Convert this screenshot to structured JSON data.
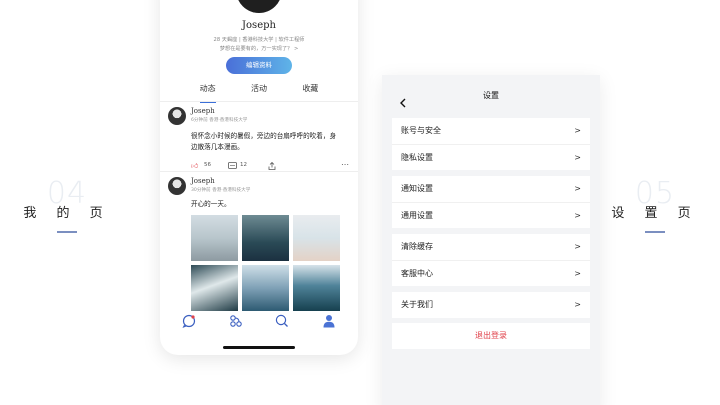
{
  "sections": {
    "left": {
      "number": "04",
      "title": "我 的 页"
    },
    "right": {
      "number": "05",
      "title": "设 置 页"
    }
  },
  "profile": {
    "name": "Joseph",
    "meta": "28 天蝎座 | 香港科技大学 | 软件工程师",
    "bio": "梦想在是要有的，万一实现了？ >",
    "edit_label": "编辑资料",
    "tabs": [
      "动态",
      "活动",
      "收藏"
    ],
    "active_tab": "动态"
  },
  "posts": [
    {
      "name": "Joseph",
      "sub": "6分钟前   香港·香港科技大学",
      "body": "很怀念小时候的暑假，旁边的台扇呼呼的吹着，身边散落几本漫画。",
      "likes": "56",
      "comments": "12"
    },
    {
      "name": "Joseph",
      "sub": "30分钟前   香港·香港科技大学",
      "body": "开心的一天。"
    }
  ],
  "settings": {
    "title": "设置",
    "groups": [
      [
        "账号与安全",
        "隐私设置"
      ],
      [
        "通知设置",
        "通用设置"
      ],
      [
        "清除缓存",
        "客服中心"
      ],
      [
        "关于我们"
      ]
    ],
    "logout": "退出登录",
    "chevron": ">"
  },
  "colors": {
    "accent": "#3b6fd8",
    "danger": "#e0414a"
  },
  "icons": [
    "message-icon",
    "connections-icon",
    "search-icon",
    "profile-icon",
    "thumb-up-icon",
    "comment-icon",
    "share-icon",
    "more-icon",
    "back-icon"
  ]
}
